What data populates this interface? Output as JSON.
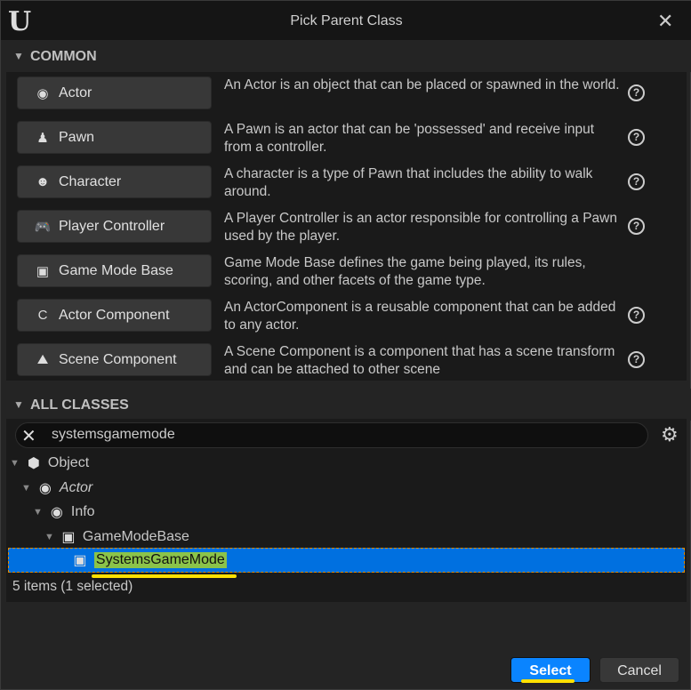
{
  "window": {
    "title": "Pick Parent Class",
    "logo": "U",
    "close_icon": "close-icon"
  },
  "common": {
    "header": "COMMON",
    "items": [
      {
        "label": "Actor",
        "icon": "actor-icon",
        "glyph": "◉",
        "desc": "An Actor is an object that can be placed or spawned in the world.",
        "help": true
      },
      {
        "label": "Pawn",
        "icon": "pawn-icon",
        "glyph": "♟",
        "desc": "A Pawn is an actor that can be 'possessed' and receive input from a controller.",
        "help": true
      },
      {
        "label": "Character",
        "icon": "character-icon",
        "glyph": "☻",
        "desc": "A character is a type of Pawn that includes the ability to walk around.",
        "help": true
      },
      {
        "label": "Player Controller",
        "icon": "gamepad-icon",
        "glyph": "🎮",
        "desc": "A Player Controller is an actor responsible for controlling a Pawn used by the player.",
        "help": true
      },
      {
        "label": "Game Mode Base",
        "icon": "game-mode-icon",
        "glyph": "▣",
        "desc": "Game Mode Base defines the game being played, its rules, scoring, and other facets of the game type.",
        "help": false
      },
      {
        "label": "Actor Component",
        "icon": "actor-component-icon",
        "glyph": "C",
        "desc": "An ActorComponent is a reusable component that can be added to any actor.",
        "help": true
      },
      {
        "label": "Scene Component",
        "icon": "scene-component-icon",
        "glyph": "⛰",
        "desc": "A Scene Component is a component that has a scene transform and can be attached to other scene",
        "help": true
      }
    ]
  },
  "all_classes": {
    "header": "ALL CLASSES",
    "search_value": "systemsgamemode",
    "tree": [
      {
        "label": "Object",
        "icon": "object-icon",
        "glyph": "⬢",
        "depth": 0,
        "italic": false
      },
      {
        "label": "Actor",
        "icon": "actor-icon",
        "glyph": "◉",
        "depth": 1,
        "italic": true
      },
      {
        "label": "Info",
        "icon": "actor-icon",
        "glyph": "◉",
        "depth": 2,
        "italic": false
      },
      {
        "label": "GameModeBase",
        "icon": "game-mode-icon",
        "glyph": "▣",
        "depth": 3,
        "italic": false
      },
      {
        "label": "SystemsGameMode",
        "icon": "game-mode-icon",
        "glyph": "▣",
        "depth": 4,
        "italic": false,
        "selected": true
      }
    ],
    "status": "5 items (1 selected)"
  },
  "footer": {
    "select": "Select",
    "cancel": "Cancel"
  },
  "colors": {
    "selection": "#0070e0",
    "select_button": "#0a84ff",
    "highlight": "#8bc34a",
    "annotation": "#ffe000"
  }
}
